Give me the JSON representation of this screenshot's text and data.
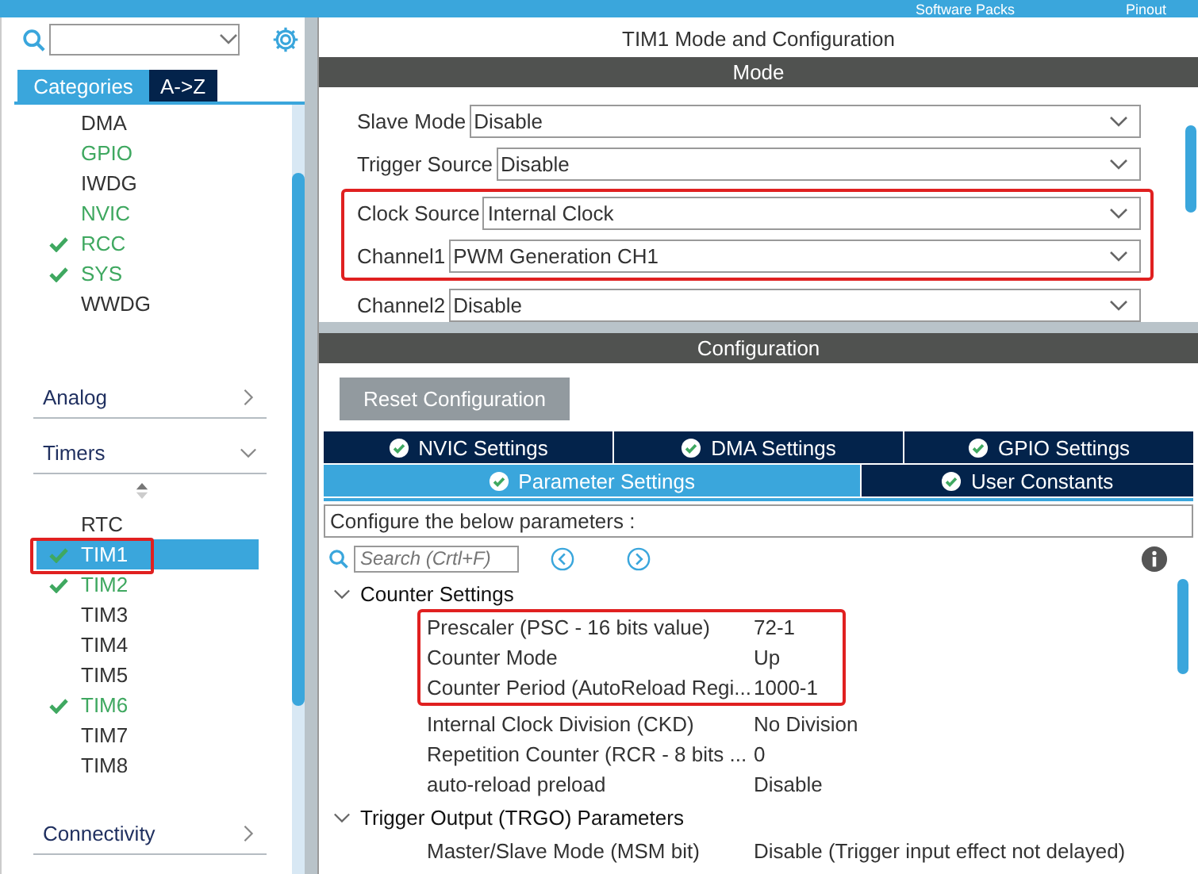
{
  "top_bar": {
    "items": [
      "Software Packs",
      "Pinout"
    ]
  },
  "sidebar": {
    "tabs": [
      {
        "label": "Categories",
        "selected": true
      },
      {
        "label": "A->Z",
        "selected": false
      }
    ],
    "system_items": [
      {
        "label": "DMA",
        "enabled": false,
        "checked": false,
        "selected": false,
        "highlighted": false
      },
      {
        "label": "GPIO",
        "enabled": true,
        "checked": false,
        "selected": false,
        "highlighted": false
      },
      {
        "label": "IWDG",
        "enabled": false,
        "checked": false,
        "selected": false,
        "highlighted": false
      },
      {
        "label": "NVIC",
        "enabled": true,
        "checked": false,
        "selected": false,
        "highlighted": false
      },
      {
        "label": "RCC",
        "enabled": true,
        "checked": true,
        "selected": false,
        "highlighted": false
      },
      {
        "label": "SYS",
        "enabled": true,
        "checked": true,
        "selected": false,
        "highlighted": false
      },
      {
        "label": "WWDG",
        "enabled": false,
        "checked": false,
        "selected": false,
        "highlighted": false
      }
    ],
    "categories": [
      {
        "label": "Analog",
        "expanded": false
      },
      {
        "label": "Timers",
        "expanded": true,
        "items": [
          {
            "label": "RTC",
            "enabled": false,
            "checked": false,
            "selected": false,
            "highlighted": false
          },
          {
            "label": "TIM1",
            "enabled": true,
            "checked": true,
            "selected": true,
            "highlighted": true
          },
          {
            "label": "TIM2",
            "enabled": true,
            "checked": true,
            "selected": false,
            "highlighted": false
          },
          {
            "label": "TIM3",
            "enabled": false,
            "checked": false,
            "selected": false,
            "highlighted": false
          },
          {
            "label": "TIM4",
            "enabled": false,
            "checked": false,
            "selected": false,
            "highlighted": false
          },
          {
            "label": "TIM5",
            "enabled": false,
            "checked": false,
            "selected": false,
            "highlighted": false
          },
          {
            "label": "TIM6",
            "enabled": true,
            "checked": true,
            "selected": false,
            "highlighted": false
          },
          {
            "label": "TIM7",
            "enabled": false,
            "checked": false,
            "selected": false,
            "highlighted": false
          },
          {
            "label": "TIM8",
            "enabled": false,
            "checked": false,
            "selected": false,
            "highlighted": false
          }
        ]
      },
      {
        "label": "Connectivity",
        "expanded": false
      }
    ]
  },
  "panel": {
    "title": "TIM1 Mode and Configuration",
    "mode": {
      "header": "Mode",
      "fields": [
        {
          "label": "Slave Mode",
          "value": "Disable",
          "highlighted": false
        },
        {
          "label": "Trigger Source",
          "value": "Disable",
          "highlighted": false
        },
        {
          "label": "Clock Source",
          "value": "Internal Clock",
          "highlighted": true
        },
        {
          "label": "Channel1",
          "value": "PWM Generation CH1",
          "highlighted": true
        },
        {
          "label": "Channel2",
          "value": "Disable",
          "highlighted": false
        }
      ]
    },
    "configuration": {
      "header": "Configuration",
      "reset_button": "Reset Configuration",
      "tabs": [
        [
          {
            "label": "NVIC Settings",
            "selected": false
          },
          {
            "label": "DMA Settings",
            "selected": false
          },
          {
            "label": "GPIO Settings",
            "selected": false
          }
        ],
        [
          {
            "label": "Parameter Settings",
            "selected": true
          },
          {
            "label": "User Constants",
            "selected": false
          }
        ]
      ],
      "description": "Configure the below parameters :",
      "search": {
        "placeholder": "Search (Crtl+F)"
      },
      "groups": [
        {
          "label": "Counter Settings",
          "expanded": true,
          "parameters": [
            {
              "name": "Prescaler (PSC - 16 bits value)",
              "value": "72-1",
              "highlighted": true
            },
            {
              "name": "Counter Mode",
              "value": "Up",
              "highlighted": true
            },
            {
              "name": "Counter Period (AutoReload Regi...",
              "value": "1000-1",
              "highlighted": true
            },
            {
              "name": "Internal Clock Division (CKD)",
              "value": "No Division",
              "highlighted": false
            },
            {
              "name": "Repetition Counter (RCR - 8 bits ...",
              "value": "0",
              "highlighted": false
            },
            {
              "name": "auto-reload preload",
              "value": "Disable",
              "highlighted": false
            }
          ]
        },
        {
          "label": "Trigger Output (TRGO) Parameters",
          "expanded": true,
          "parameters": [
            {
              "name": "Master/Slave Mode (MSM bit)",
              "value": "Disable (Trigger input effect not delayed)",
              "highlighted": false
            }
          ]
        }
      ]
    }
  }
}
